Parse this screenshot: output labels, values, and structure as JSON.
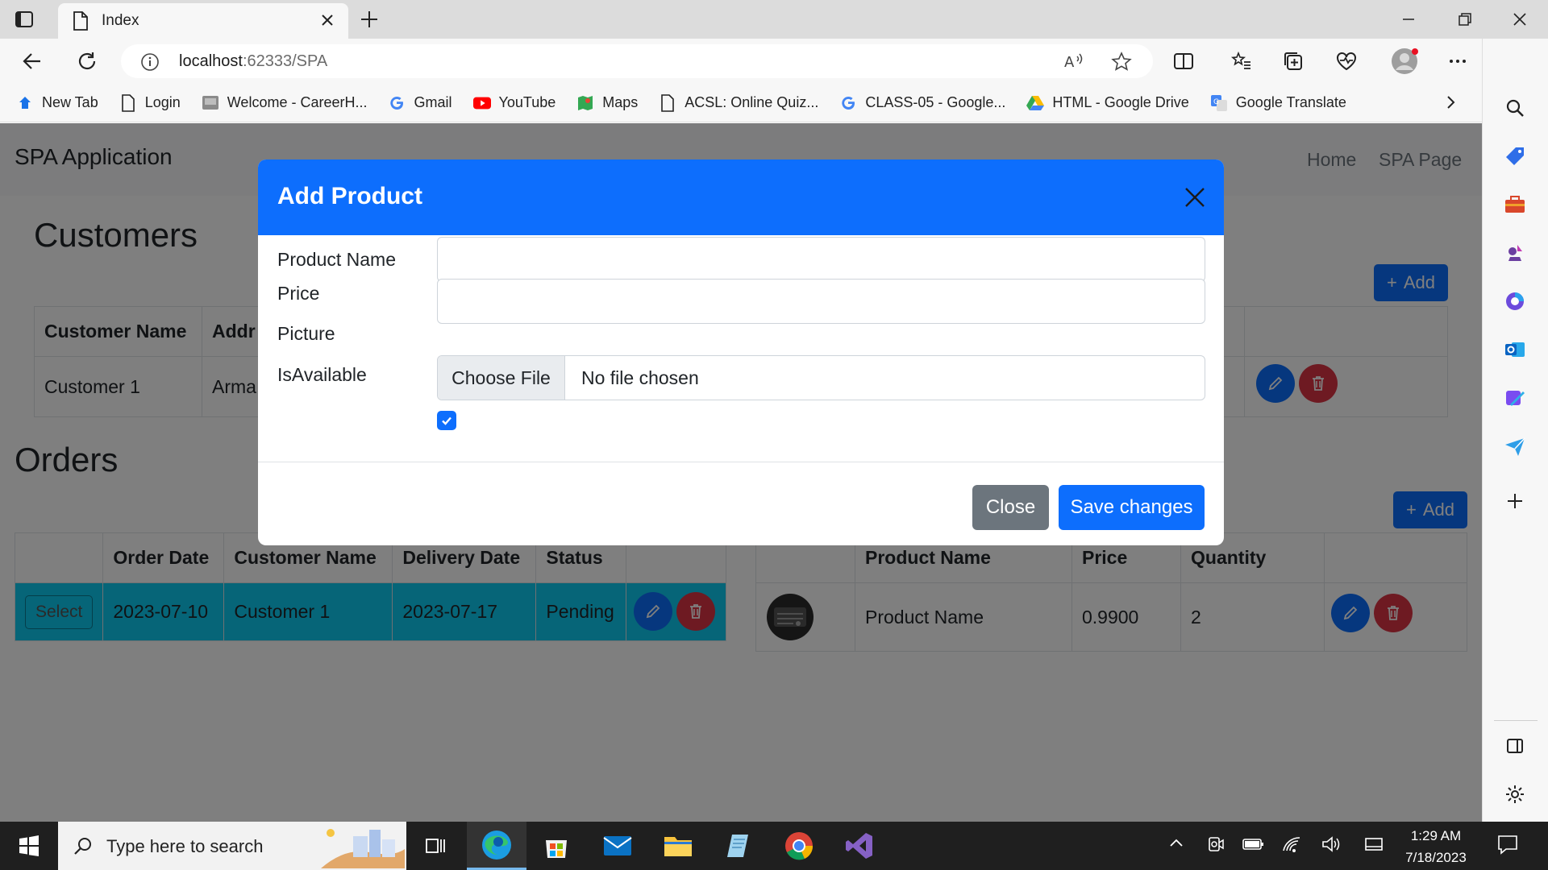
{
  "browser": {
    "tab_title": "Index",
    "url_host": "localhost",
    "url_path": ":62333/SPA",
    "bookmarks": [
      {
        "label": "New Tab",
        "icon": "edge-icon"
      },
      {
        "label": "Login",
        "icon": "page-icon"
      },
      {
        "label": "Welcome - CareerH...",
        "icon": "careerh-icon"
      },
      {
        "label": "Gmail",
        "icon": "google-icon"
      },
      {
        "label": "YouTube",
        "icon": "youtube-icon"
      },
      {
        "label": "Maps",
        "icon": "maps-icon"
      },
      {
        "label": "ACSL: Online Quiz...",
        "icon": "page-icon"
      },
      {
        "label": "CLASS-05 - Google...",
        "icon": "google-icon"
      },
      {
        "label": "HTML - Google Drive",
        "icon": "drive-icon"
      },
      {
        "label": "Google Translate",
        "icon": "translate-icon"
      }
    ]
  },
  "app": {
    "brand": "SPA Application",
    "nav": {
      "home": "Home",
      "spa": "SPA Page"
    },
    "customers": {
      "title": "Customers",
      "add_label": "Add",
      "headers": [
        "Customer Name",
        "Addr"
      ],
      "rows": [
        {
          "name": "Customer 1",
          "address": "Arma"
        }
      ]
    },
    "orders": {
      "title": "Orders",
      "add_label": "Add",
      "headers": [
        "",
        "Order Date",
        "Customer Name",
        "Delivery Date",
        "Status",
        ""
      ],
      "select_label": "Select",
      "rows": [
        {
          "order_date": "2023-07-10",
          "customer": "Customer 1",
          "delivery": "2023-07-17",
          "status": "Pending"
        }
      ]
    },
    "order_items": {
      "headers": [
        "",
        "Product Name",
        "Price",
        "Quantity",
        ""
      ],
      "rows": [
        {
          "product": "Product Name",
          "price": "0.9900",
          "quantity": "2"
        }
      ]
    }
  },
  "modal": {
    "title": "Add Product",
    "fields": {
      "product_name": "Product Name",
      "price": "Price",
      "picture": "Picture",
      "is_available": "IsAvailable"
    },
    "product_name_value": "",
    "price_value": "",
    "choose_file": "Choose File",
    "no_file": "No file chosen",
    "is_available_checked": true,
    "close_label": "Close",
    "save_label": "Save changes"
  },
  "taskbar": {
    "search_placeholder": "Type here to search",
    "time": "1:29 AM",
    "date": "7/18/2023"
  },
  "colors": {
    "primary": "#0d6efd",
    "danger": "#dc3545",
    "secondary": "#6c757d",
    "selected_row": "#0dcaf0"
  }
}
